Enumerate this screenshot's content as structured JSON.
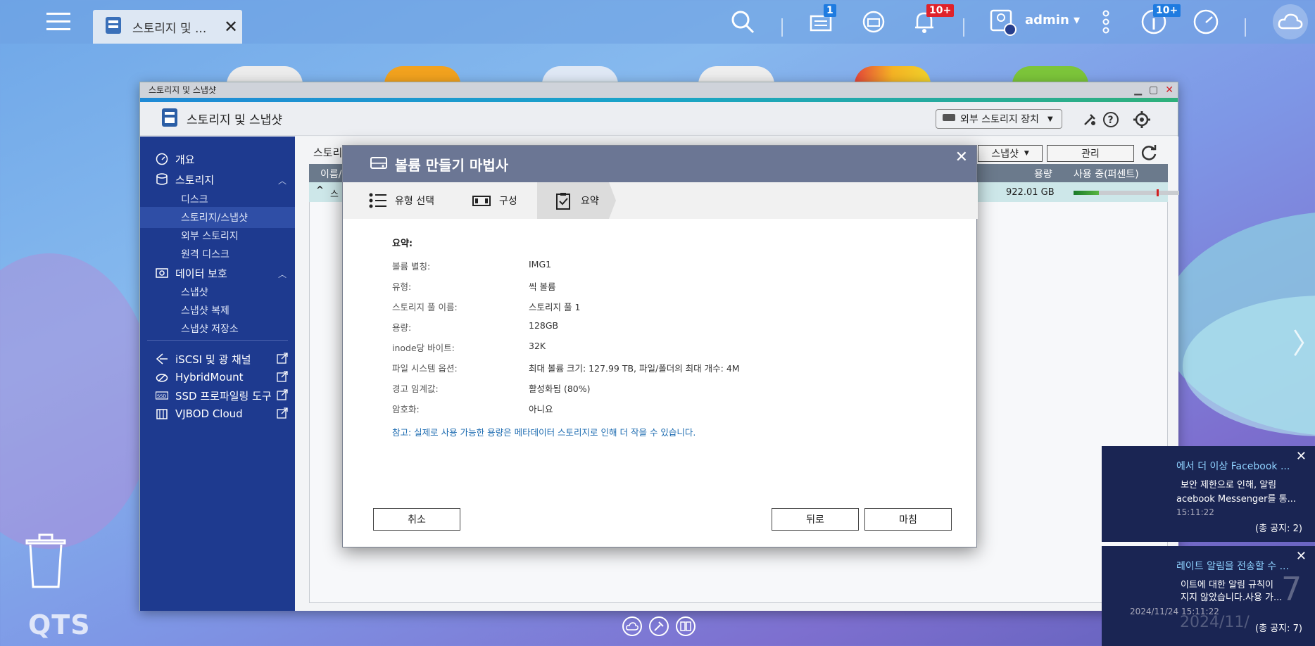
{
  "taskbar": {
    "tab_title": "스토리지 및 ...",
    "badges": {
      "tasks": "1",
      "notifications": "10+",
      "info": "10+"
    },
    "user": "admin"
  },
  "window": {
    "title_bar": "스토리지 및 스냅샷",
    "header_title": "스토리지 및 스냅샷",
    "external_storage_dropdown": "외부 스토리지 장치"
  },
  "sidebar": {
    "items": [
      {
        "label": "개요"
      },
      {
        "label": "스토리지"
      },
      {
        "label": "디스크"
      },
      {
        "label": "스토리지/스냅샷"
      },
      {
        "label": "외부 스토리지"
      },
      {
        "label": "원격 디스크"
      },
      {
        "label": "데이터 보호"
      },
      {
        "label": "스냅샷"
      },
      {
        "label": "스냅샷 복제"
      },
      {
        "label": "스냅샷 저장소"
      },
      {
        "label": "iSCSI 및 광 채널"
      },
      {
        "label": "HybridMount"
      },
      {
        "label": "SSD 프로파일링 도구"
      },
      {
        "label": "VJBOD Cloud"
      }
    ]
  },
  "content": {
    "page_title": "스토리",
    "snapshot_dd": "스냅샷",
    "manage_btn": "관리",
    "table_headers": {
      "name": "이름/",
      "capacity": "용량",
      "usage": "사용 중(퍼센트)"
    },
    "row": {
      "name_prefix": "스",
      "capacity": "922.01 GB",
      "usage_fraction": 0.24
    }
  },
  "modal": {
    "title": "볼륨 만들기 마법사",
    "steps": [
      {
        "label": "유형 선택"
      },
      {
        "label": "구성"
      },
      {
        "label": "요약"
      }
    ],
    "summary_heading": "요약:",
    "summary": [
      {
        "key": "볼륨 별칭:",
        "value": "IMG1"
      },
      {
        "key": "유형:",
        "value": "씩 볼륨"
      },
      {
        "key": "스토리지 풀 이름:",
        "value": "스토리지 풀 1"
      },
      {
        "key": "용량:",
        "value": "128GB"
      },
      {
        "key": "inode당 바이트:",
        "value": "32K"
      },
      {
        "key": "파일 시스템 옵션:",
        "value": "최대 볼륨 크기: 127.99 TB, 파일/폴더의 최대 개수: 4M"
      },
      {
        "key": "경고 임계값:",
        "value": "활성화됨 (80%)"
      },
      {
        "key": "암호화:",
        "value": "아니요"
      }
    ],
    "note": "참고: 실제로 사용 가능한 용량은 메타데이터 스토리지로 인해 더 작을 수 있습니다.",
    "cancel": "취소",
    "back": "뒤로",
    "finish": "마침"
  },
  "notifications": [
    {
      "title": "에서 더 이상 Facebook ...",
      "line1": "보안 제한으로 인해, 알림",
      "line2": "acebook Messenger를 통...",
      "time": "15:11:22",
      "count": "(총 공지: 2)"
    },
    {
      "title": "레이트 알림을 전송할 수 ...",
      "line1": "이트에 대한 알림 규칙이",
      "line2": "지지 않았습니다.사용 가...",
      "time": "2024/11/24 15:11:22",
      "count": "(총 공지: 7)"
    }
  ],
  "desktop": {
    "qts_label": "QTS",
    "faded_date": "2024/11/",
    "faded_num": "7"
  }
}
